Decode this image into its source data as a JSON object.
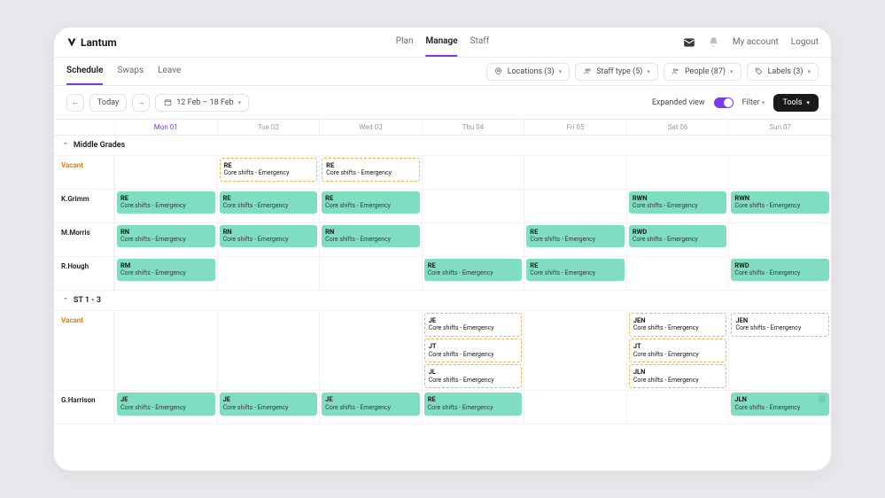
{
  "brand": "Lantum",
  "topnav": {
    "plan": "Plan",
    "manage": "Manage",
    "staff": "Staff"
  },
  "topright": {
    "account": "My account",
    "logout": "Logout"
  },
  "subtabs": {
    "schedule": "Schedule",
    "swaps": "Swaps",
    "leave": "Leave"
  },
  "filters": {
    "locations": "Locations (3)",
    "stafftype": "Staff type (5)",
    "people": "People (87)",
    "labels": "Labels (3)"
  },
  "toolbar": {
    "today": "Today",
    "date_range": "12 Feb – 18 Feb",
    "expanded": "Expanded view",
    "filter": "Filter",
    "tools": "Tools"
  },
  "days": [
    "Mon 01",
    "Tue 02",
    "Wed 03",
    "Thu 04",
    "Fri 05",
    "Sat 06",
    "Sun 07"
  ],
  "desc": "Core shifts - Emergency",
  "groups": [
    {
      "name": "Middle Grades",
      "rows": [
        {
          "label": "Vacant",
          "kind": "vacant",
          "cells": [
            [],
            [
              {
                "code": "RE",
                "v": true
              }
            ],
            [
              {
                "code": "RE",
                "v": true
              }
            ],
            [],
            [],
            [],
            []
          ]
        },
        {
          "label": "K.Grimm",
          "kind": "person",
          "cells": [
            [
              {
                "code": "RE"
              }
            ],
            [
              {
                "code": "RE"
              }
            ],
            [
              {
                "code": "RE"
              }
            ],
            [],
            [],
            [
              {
                "code": "RWN"
              }
            ],
            [
              {
                "code": "RWN"
              }
            ]
          ]
        },
        {
          "label": "M.Morris",
          "kind": "person",
          "cells": [
            [
              {
                "code": "RN"
              }
            ],
            [
              {
                "code": "RN"
              }
            ],
            [
              {
                "code": "RN"
              }
            ],
            [],
            [
              {
                "code": "RE"
              }
            ],
            [
              {
                "code": "RWD"
              }
            ],
            []
          ]
        },
        {
          "label": "R.Hough",
          "kind": "person",
          "cells": [
            [
              {
                "code": "RM"
              }
            ],
            [],
            [],
            [
              {
                "code": "RE"
              }
            ],
            [
              {
                "code": "RE"
              }
            ],
            [],
            [
              {
                "code": "RWD"
              }
            ]
          ]
        }
      ]
    },
    {
      "name": "ST 1 - 3",
      "rows": [
        {
          "label": "Vacant",
          "kind": "vacant",
          "cells": [
            [],
            [],
            [],
            [
              {
                "code": "JE",
                "v": true
              },
              {
                "code": "JT",
                "v": true
              },
              {
                "code": "JL",
                "v": true
              }
            ],
            [],
            [
              {
                "code": "JEN",
                "v": true
              },
              {
                "code": "JT",
                "v": true
              },
              {
                "code": "JLN",
                "v": true
              }
            ],
            [
              {
                "code": "JEN",
                "v": true
              }
            ]
          ]
        },
        {
          "label": "G.Harrison",
          "kind": "person",
          "cells": [
            [
              {
                "code": "JE"
              }
            ],
            [
              {
                "code": "JE"
              }
            ],
            [
              {
                "code": "JE"
              }
            ],
            [
              {
                "code": "RE"
              }
            ],
            [],
            [],
            [
              {
                "code": "JLN",
                "badge": true
              }
            ]
          ]
        }
      ]
    }
  ]
}
